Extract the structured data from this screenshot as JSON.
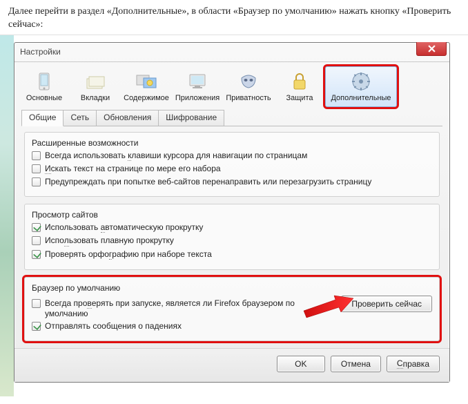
{
  "instruction": "Далее перейти в раздел «Дополнительные», в области «Браузер по умолчанию» нажать кнопку «Проверить сейчас»:",
  "window": {
    "title": "Настройки",
    "close_icon": "x"
  },
  "toolbar": {
    "items": [
      {
        "name": "main-icon",
        "label": "Основные"
      },
      {
        "name": "tabs-icon",
        "label": "Вкладки"
      },
      {
        "name": "content-icon",
        "label": "Содержимое"
      },
      {
        "name": "apps-icon",
        "label": "Приложения"
      },
      {
        "name": "privacy-icon",
        "label": "Приватность"
      },
      {
        "name": "security-icon",
        "label": "Защита"
      },
      {
        "name": "advanced-icon",
        "label": "Дополнительные"
      }
    ]
  },
  "subtabs": [
    "Общие",
    "Сеть",
    "Обновления",
    "Шифрование"
  ],
  "group_extended": {
    "legend": "Расширенные возможности",
    "items": [
      {
        "checked": false,
        "label_pre": "Всегда использовать ",
        "label_u": "к",
        "label_post": "лавиши курсора для навигации по страницам"
      },
      {
        "checked": false,
        "label_pre": "",
        "label_u": "И",
        "label_post": "скать текст на странице по мере его набора"
      },
      {
        "checked": false,
        "label_pre": "Предупреждать при попытке веб-сайтов перенаправить или перезагрузить страницу",
        "label_u": "",
        "label_post": ""
      }
    ]
  },
  "group_browsing": {
    "legend": "Просмотр сайтов",
    "items": [
      {
        "checked": true,
        "label_pre": "Использовать ",
        "label_u": "а",
        "label_post": "втоматическую прокрутку"
      },
      {
        "checked": false,
        "label_pre": "Испо",
        "label_u": "л",
        "label_post": "ьзовать плавную прокрутку"
      },
      {
        "checked": true,
        "label_pre": "Проверять орфо",
        "label_u": "г",
        "label_post": "рафию при наборе текста"
      }
    ]
  },
  "group_default": {
    "legend": "Браузер по умолчанию",
    "check1_pre": "Всегда про",
    "check1_u": "в",
    "check1_post": "ерять при запуске, является ли Firefox браузером по умолчанию",
    "check2": "Отправлять сообщения о падениях",
    "button": "Проверить сейчас"
  },
  "buttons": {
    "ok": "OK",
    "cancel": "Отмена",
    "help_u": "С",
    "help_post": "правка"
  }
}
